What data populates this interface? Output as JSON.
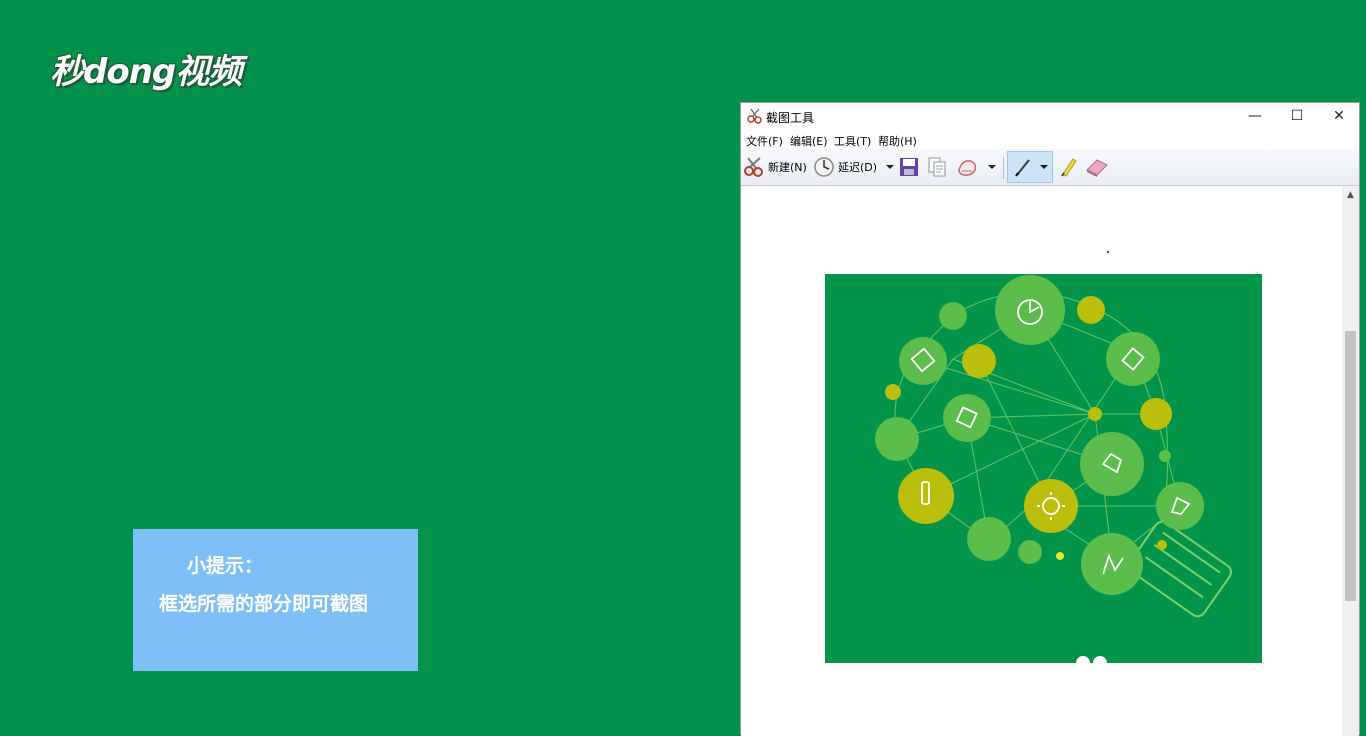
{
  "brand": {
    "logo_text": "秒dong视频"
  },
  "tip": {
    "title": "小提示：",
    "body": "框选所需的部分即可截图"
  },
  "window": {
    "title": "截图工具",
    "controls": {
      "minimize": "—",
      "maximize": "☐",
      "close": "✕"
    },
    "menu": [
      "文件(F)",
      "编辑(E)",
      "工具(T)",
      "帮助(H)"
    ],
    "toolbar": {
      "new_label": "新建(N)",
      "delay_label": "延迟(D)"
    }
  },
  "colors": {
    "background": "#01914b",
    "tip_box": "#7fbff7",
    "capture_bg": "#03944b",
    "bubble_light": "#5bbd4a",
    "bubble_yellow": "#b9bf0a"
  },
  "icons": [
    "scissors-icon",
    "clock-icon",
    "save-icon",
    "copy-icon",
    "eraser-shape-icon",
    "pen-icon",
    "highlighter-icon",
    "eraser-icon"
  ]
}
